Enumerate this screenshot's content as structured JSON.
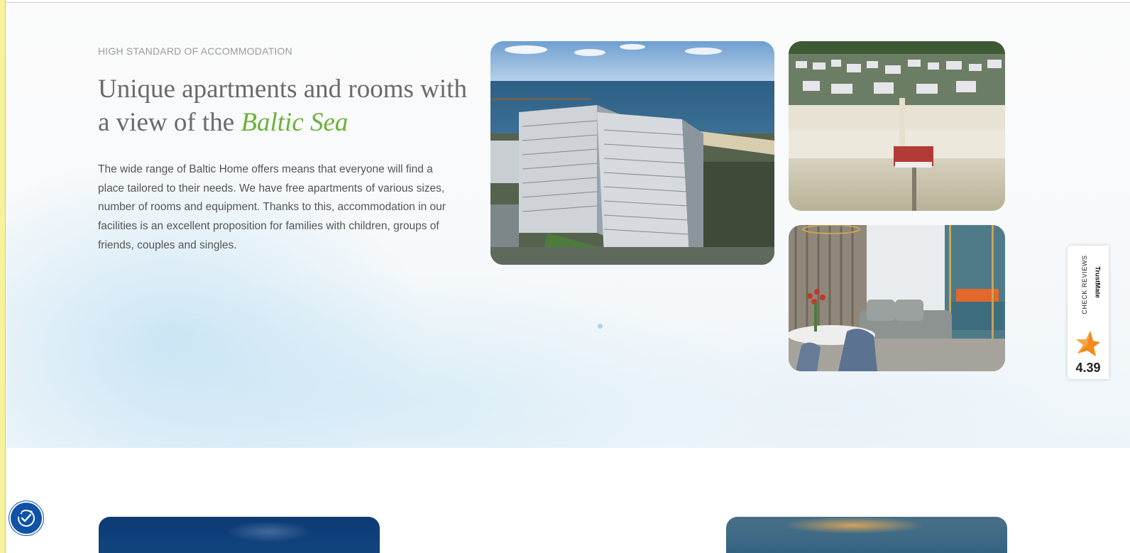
{
  "section": {
    "eyebrow": "HIGH STANDARD OF ACCOMMODATION",
    "headline_part1": "Unique apartments and rooms with a view of the ",
    "headline_accent": "Baltic Sea",
    "body": "The wide range of Baltic Home offers means that everyone will find a place tailored to their needs. We have free apartments of various sizes, number of rooms and equipment. Thanks to this, accommodation in our facilities is an excellent proposition for families with children, groups of friends, couples and singles."
  },
  "colors": {
    "accent_green": "#6bb13a",
    "heading_gray": "#6a6a6a",
    "a11y_blue": "#0f52a8",
    "trust_orange": "#f28a1c"
  },
  "photos": [
    {
      "icon": "seaside-apartment-buildings-photo"
    },
    {
      "icon": "pier-and-beach-aerial-photo"
    },
    {
      "icon": "apartment-living-room-photo"
    }
  ],
  "trust_widget": {
    "label": "CHECK REVIEWS",
    "brand": "TrustMate",
    "score": "4.39",
    "icon": "star-icon"
  },
  "accessibility_button": {
    "icon": "accessibility-icon"
  }
}
